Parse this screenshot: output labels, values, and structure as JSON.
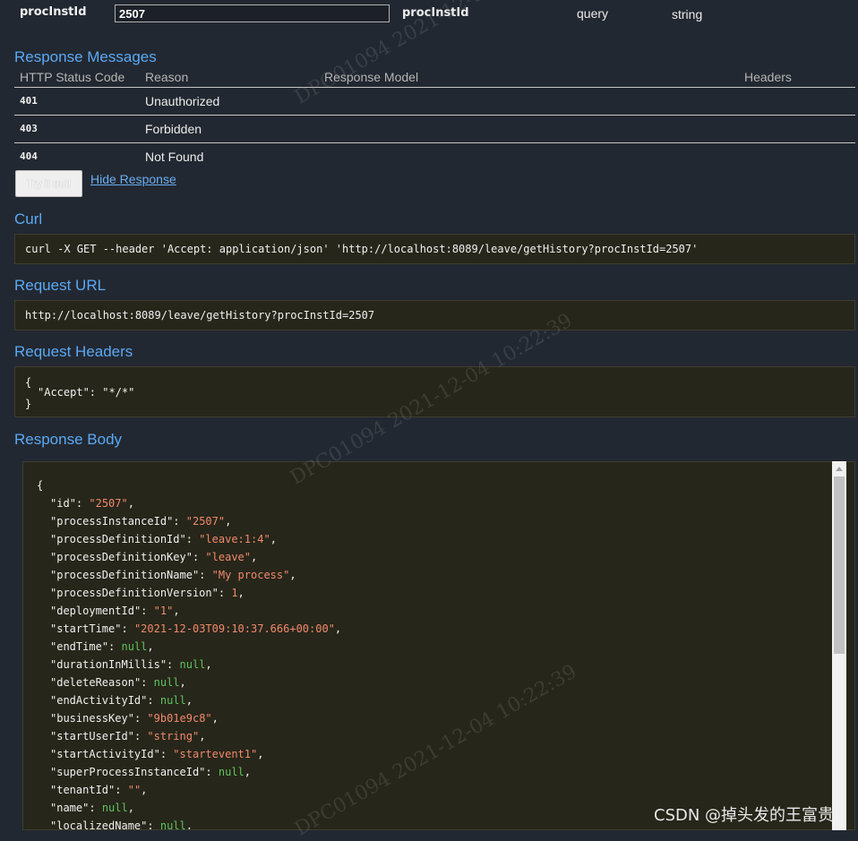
{
  "parameter": {
    "name": "procInstId",
    "value": "2507",
    "description": "procInstId",
    "param_type": "query",
    "data_type": "string"
  },
  "response_messages": {
    "title": "Response Messages",
    "headers": [
      "HTTP Status Code",
      "Reason",
      "Response Model",
      "Headers"
    ],
    "rows": [
      {
        "code": "401",
        "reason": "Unauthorized"
      },
      {
        "code": "403",
        "reason": "Forbidden"
      },
      {
        "code": "404",
        "reason": "Not Found"
      }
    ]
  },
  "actions": {
    "try_label": "Try it out!",
    "hide_label": "Hide Response"
  },
  "curl": {
    "title": "Curl",
    "command": "curl -X GET --header 'Accept: application/json' 'http://localhost:8089/leave/getHistory?procInstId=2507'"
  },
  "request_url": {
    "title": "Request URL",
    "url": "http://localhost:8089/leave/getHistory?procInstId=2507"
  },
  "request_headers": {
    "title": "Request Headers",
    "open": "{",
    "line": "\"Accept\": \"*/*\"",
    "close": "}"
  },
  "response_body": {
    "title": "Response Body",
    "open": "{",
    "fields": [
      {
        "key": "id",
        "value": "\"2507\"",
        "kind": "s"
      },
      {
        "key": "processInstanceId",
        "value": "\"2507\"",
        "kind": "s"
      },
      {
        "key": "processDefinitionId",
        "value": "\"leave:1:4\"",
        "kind": "s"
      },
      {
        "key": "processDefinitionKey",
        "value": "\"leave\"",
        "kind": "s"
      },
      {
        "key": "processDefinitionName",
        "value": "\"My process\"",
        "kind": "s"
      },
      {
        "key": "processDefinitionVersion",
        "value": "1",
        "kind": "n"
      },
      {
        "key": "deploymentId",
        "value": "\"1\"",
        "kind": "s"
      },
      {
        "key": "startTime",
        "value": "\"2021-12-03T09:10:37.666+00:00\"",
        "kind": "s"
      },
      {
        "key": "endTime",
        "value": "null",
        "kind": "nl"
      },
      {
        "key": "durationInMillis",
        "value": "null",
        "kind": "nl"
      },
      {
        "key": "deleteReason",
        "value": "null",
        "kind": "nl"
      },
      {
        "key": "endActivityId",
        "value": "null",
        "kind": "nl"
      },
      {
        "key": "businessKey",
        "value": "\"9b01e9c8\"",
        "kind": "s"
      },
      {
        "key": "startUserId",
        "value": "\"string\"",
        "kind": "s"
      },
      {
        "key": "startActivityId",
        "value": "\"startevent1\"",
        "kind": "s"
      },
      {
        "key": "superProcessInstanceId",
        "value": "null",
        "kind": "nl"
      },
      {
        "key": "tenantId",
        "value": "\"\"",
        "kind": "s"
      },
      {
        "key": "name",
        "value": "null",
        "kind": "nl"
      },
      {
        "key": "localizedName",
        "value": "null",
        "kind": "nl"
      }
    ]
  },
  "watermarks": [
    "DPC01094   2021-12-04   10:22:39",
    "DPC01094   2021-12-04   10:22:39",
    "DPC01094   2021-12-04   10:22:39"
  ],
  "footer_credit": "CSDN @掉头发的王富贵",
  "colors": {
    "background": "#222831",
    "section_title": "#5aa9f5",
    "code_bg": "#27261a",
    "json_string": "#f08a6c",
    "json_null": "#5cc45c"
  }
}
